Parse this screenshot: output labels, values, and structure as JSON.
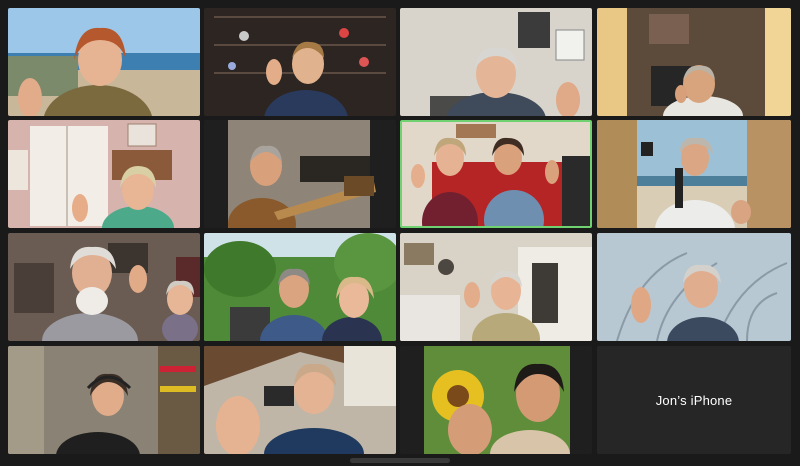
{
  "meeting": {
    "participants": [
      {
        "id": "p1"
      },
      {
        "id": "p2"
      },
      {
        "id": "p3"
      },
      {
        "id": "p4"
      },
      {
        "id": "p5"
      },
      {
        "id": "p6"
      },
      {
        "id": "p7",
        "active_speaker": true
      },
      {
        "id": "p8"
      },
      {
        "id": "p9"
      },
      {
        "id": "p10"
      },
      {
        "id": "p11"
      },
      {
        "id": "p12"
      },
      {
        "id": "p13"
      },
      {
        "id": "p14"
      },
      {
        "id": "p15"
      },
      {
        "id": "p16",
        "display_name": "Jon’s iPhone",
        "video": false
      }
    ]
  },
  "colors": {
    "background": "#1a1a1a",
    "active_speaker_border": "#6fd16f",
    "name_text": "#ffffff"
  }
}
